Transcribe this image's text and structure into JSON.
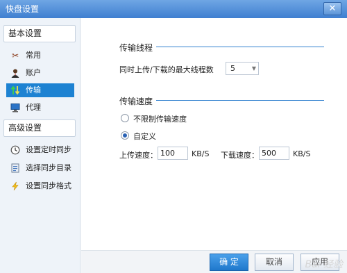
{
  "window": {
    "title": "快盘设置",
    "close_glyph": "✕"
  },
  "sidebar": {
    "basic_header": "基本设置",
    "advanced_header": "高级设置",
    "basic_items": [
      {
        "label": "常用",
        "icon": "tools-icon"
      },
      {
        "label": "账户",
        "icon": "user-icon"
      },
      {
        "label": "传输",
        "icon": "transfer-icon",
        "selected": true
      },
      {
        "label": "代理",
        "icon": "monitor-icon"
      }
    ],
    "advanced_items": [
      {
        "label": "设置定时同步",
        "icon": "clock-icon"
      },
      {
        "label": "选择同步目录",
        "icon": "folder-icon"
      },
      {
        "label": "设置同步格式",
        "icon": "lightning-icon"
      }
    ]
  },
  "main": {
    "threads": {
      "title": "传输线程",
      "max_label": "同时上传/下载的最大线程数",
      "max_value": "5"
    },
    "speed": {
      "title": "传输速度",
      "unlimited_label": "不限制传输速度",
      "custom_label": "自定义",
      "selected": "custom",
      "upload_label": "上传速度：",
      "upload_value": "100",
      "upload_unit": "KB/S",
      "download_label": "下载速度：",
      "download_value": "500",
      "download_unit": "KB/S"
    }
  },
  "footer": {
    "ok": "确 定",
    "cancel": "取消",
    "apply": "应用"
  },
  "watermark": "Bai 经验"
}
